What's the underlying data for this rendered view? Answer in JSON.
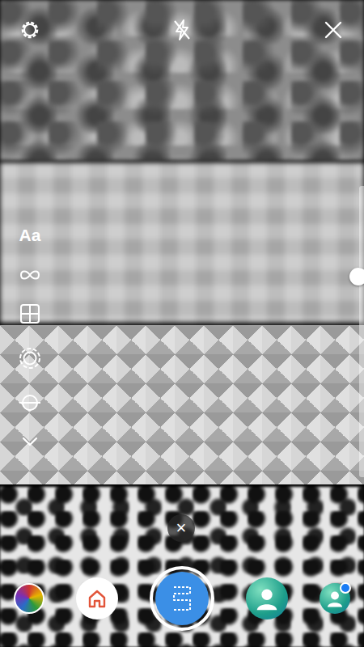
{
  "text_tool": {
    "label": "Aa"
  },
  "layout_close": {
    "label": "×"
  },
  "zoom_slider": {
    "level": 0.69
  },
  "effects": [
    {
      "kind": "home",
      "selected": false,
      "has_new": false
    },
    {
      "kind": "layout",
      "selected": true,
      "has_new": false
    },
    {
      "kind": "avatar",
      "selected": false,
      "has_new": false
    },
    {
      "kind": "avatar",
      "selected": false,
      "has_new": true
    }
  ]
}
